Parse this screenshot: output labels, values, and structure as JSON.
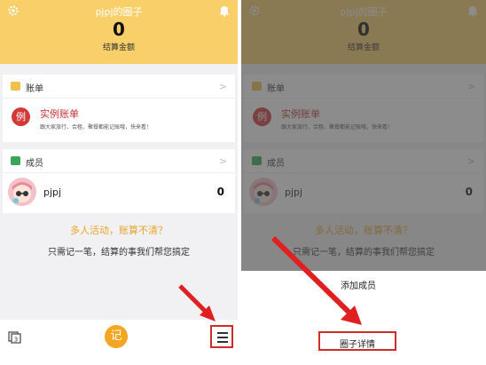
{
  "header": {
    "title": "pjpj的圈子",
    "amount": "0",
    "amount_label": "结算金额"
  },
  "bills": {
    "section_label": "账单",
    "example_badge": "例",
    "example_title": "实例账单",
    "example_desc": "跟大家旅行、合租、聚餐都能记账哦，快来看！"
  },
  "members": {
    "section_label": "成员",
    "list": [
      {
        "name": "pjpj",
        "amount": "0"
      }
    ]
  },
  "promo": {
    "line1": "多人活动，账算不清？",
    "line2": "只需记一笔，结算的事我们帮您搞定"
  },
  "bottom_bar": {
    "record_label": "记",
    "book_count": "3"
  },
  "sheet": {
    "add_member": "添加成员",
    "circle_details": "圈子详情"
  },
  "colors": {
    "header": "#f9cf6a",
    "accent": "#f4a623",
    "highlight": "#d42a2a",
    "example_red": "#c43030"
  }
}
